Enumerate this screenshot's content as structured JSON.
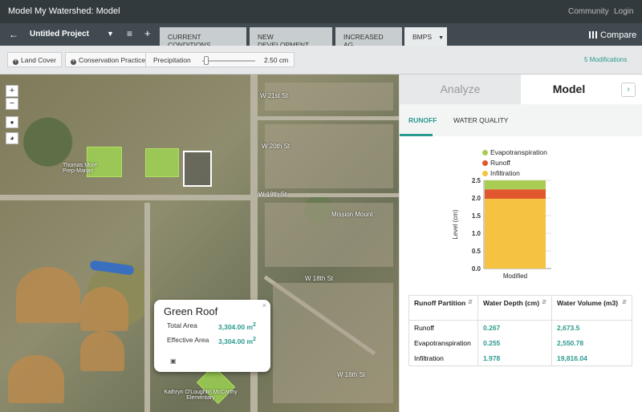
{
  "topbar": {
    "brand": "Model My Watershed: Model",
    "community": "Community",
    "login": "Login"
  },
  "project": {
    "back_icon": "arrow-left-icon",
    "title": "Untitled Project",
    "menu_icon": "hamburger-icon",
    "add_icon": "plus-icon"
  },
  "tabs": [
    {
      "label": "CURRENT CONDITIONS",
      "active": false
    },
    {
      "label": "NEW DEVELOPMENT",
      "active": false
    },
    {
      "label": "INCREASED AG",
      "active": false
    },
    {
      "label": "BMPS",
      "active": true
    }
  ],
  "compare": {
    "label": "Compare"
  },
  "toolbar": {
    "land_cover": "Land Cover",
    "conservation": "Conservation Practice",
    "precip_label": "Precipitation",
    "precip_value": "2.50 cm",
    "precip_fraction": 0.07,
    "modifications": "5 Modifications"
  },
  "map": {
    "zoom_in": "+",
    "zoom_out": "−",
    "labels": {
      "street1": "W 21st St",
      "street2": "W 20th St",
      "street3": "W 19th St",
      "street4": "W 18th St",
      "street5": "W 16th St",
      "school": "Thomas More Prep-Marian",
      "mission": "Mission Mount",
      "elem": "Kathryn O'Loughlin McCarthy Elementary"
    }
  },
  "popup": {
    "title": "Green Roof",
    "close": "×",
    "total_label": "Total Area",
    "total_value": "3,304.00 m",
    "effective_label": "Effective Area",
    "effective_value": "3,304.00 m",
    "sup": "2"
  },
  "panel": {
    "analyze": "Analyze",
    "model": "Model",
    "next": "›",
    "subtabs": {
      "runoff": "RUNOFF",
      "water_quality": "WATER QUALITY"
    }
  },
  "chart_data": {
    "type": "bar",
    "categories": [
      "Modified"
    ],
    "series": [
      {
        "name": "Infiltration",
        "values": [
          1.978
        ],
        "color": "#f5c242"
      },
      {
        "name": "Runoff",
        "values": [
          0.267
        ],
        "color": "#e0572d"
      },
      {
        "name": "Evapotranspiration",
        "values": [
          0.255
        ],
        "color": "#a9cc52"
      }
    ],
    "ylabel": "Level (cm)",
    "ylim": [
      0,
      2.5
    ],
    "ticks": [
      "0.0",
      "0.5",
      "1.0",
      "1.5",
      "2.0",
      "2.5"
    ],
    "legend": [
      "Evapotranspiration",
      "Runoff",
      "Infiltration"
    ],
    "stacked": true
  },
  "table": {
    "headers": [
      "Runoff Partition",
      "Water Depth (cm)",
      "Water Volume (m3)"
    ],
    "rows": [
      {
        "name": "Runoff",
        "depth": "0.267",
        "volume": "2,673.5"
      },
      {
        "name": "Evapotranspiration",
        "depth": "0.255",
        "volume": "2,550.78"
      },
      {
        "name": "Infiltration",
        "depth": "1.978",
        "volume": "19,816.04"
      }
    ]
  }
}
